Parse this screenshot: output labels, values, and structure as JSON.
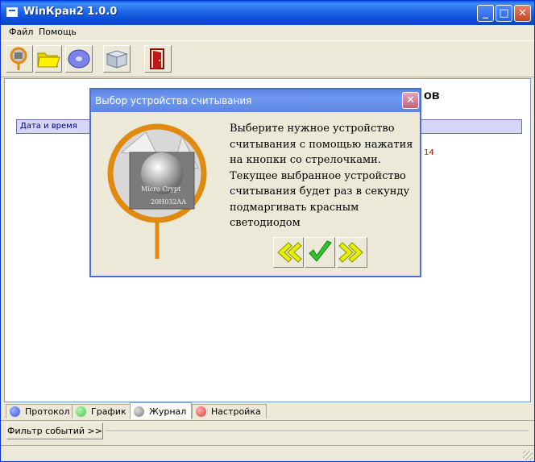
{
  "window": {
    "title": "WinКран2 1.0.0"
  },
  "menu": [
    "Файл",
    "Помощь"
  ],
  "toolbar": {
    "icons": [
      "reader-search-icon",
      "open-folder-icon",
      "disk-icon",
      "box-icon",
      "exit-door-icon"
    ]
  },
  "content": {
    "heading_fragment": "ов",
    "column_header": "Дата и время",
    "red_text_fragment": "14"
  },
  "dialog": {
    "title": "Выбор устройства считывания",
    "message": "Выберите нужное устройство\nсчитывания с помощью нажатия\nна кнопки со стрелочками.\nТекущее выбранное устройство\nсчитывания будет раз в секунду\nподмаргивать красным\nсветодиодом",
    "chip_text_1": "Micro Crypt",
    "chip_text_2": "20H032AA"
  },
  "tabs": [
    {
      "label": "Протокол",
      "color": "#3a55d8"
    },
    {
      "label": "График",
      "color": "#3fc43f"
    },
    {
      "label": "Журнал",
      "color": "#8a8a8a",
      "active": true
    },
    {
      "label": "Настройка",
      "color": "#e03a3a"
    }
  ],
  "filter": {
    "button_label": "Фильтр событий >>"
  },
  "colors": {
    "title_blue": "#0a5fe8",
    "dialog_blue": "#5b84e6",
    "window_bg": "#ece9d8"
  }
}
